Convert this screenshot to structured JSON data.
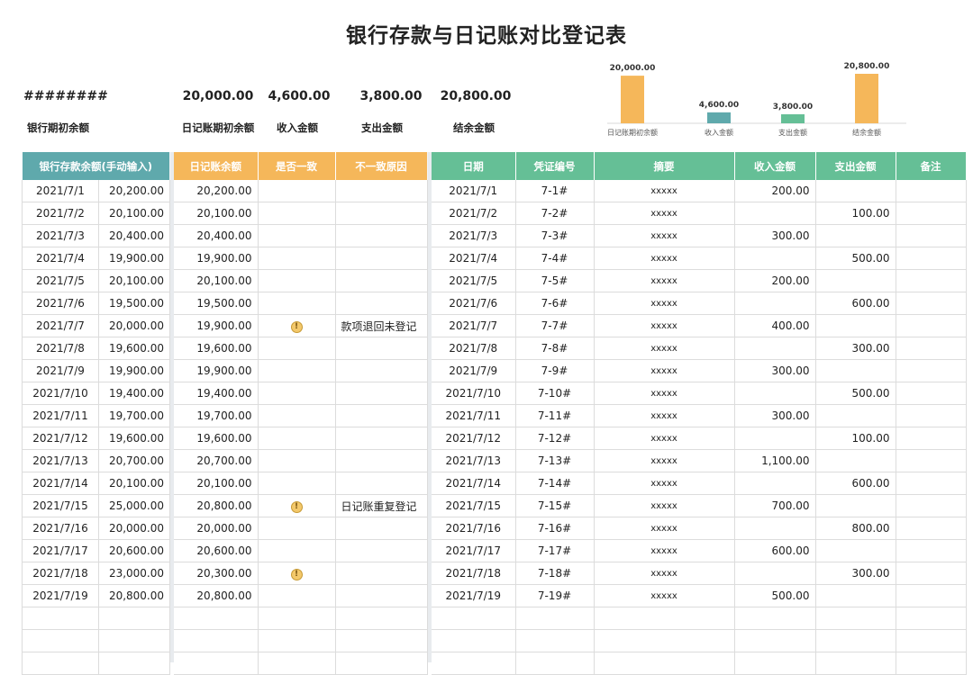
{
  "title": "银行存款与日记账对比登记表",
  "summary": {
    "bank_initial_value": "########",
    "bank_initial_label": "银行期初余额",
    "journal_initial_value": "20,000.00",
    "journal_initial_label": "日记账期初余额",
    "income_value": "4,600.00",
    "income_label": "收入金额",
    "expense_value": "3,800.00",
    "expense_label": "支出金额",
    "ending_value": "20,800.00",
    "ending_label": "结余金额"
  },
  "chart_data": {
    "type": "bar",
    "categories": [
      "日记账期初余额",
      "收入金额",
      "支出金额",
      "结余金额"
    ],
    "values": [
      20000,
      4600,
      3800,
      20800
    ],
    "value_labels": [
      "20,000.00",
      "4,600.00",
      "3,800.00",
      "20,800.00"
    ],
    "colors": [
      "#f5b75a",
      "#5fa9ac",
      "#65bf96",
      "#f5b75a"
    ],
    "ylim": [
      0,
      20800
    ],
    "grid": false
  },
  "colors": {
    "teal": "#5fa9ac",
    "orange": "#f5b75a",
    "green": "#65bf96"
  },
  "bank_table": {
    "header": "银行存款余额(手动输入)",
    "rows": [
      [
        "2021/7/1",
        "20,200.00"
      ],
      [
        "2021/7/2",
        "20,100.00"
      ],
      [
        "2021/7/3",
        "20,400.00"
      ],
      [
        "2021/7/4",
        "19,900.00"
      ],
      [
        "2021/7/5",
        "20,100.00"
      ],
      [
        "2021/7/6",
        "19,500.00"
      ],
      [
        "2021/7/7",
        "20,000.00"
      ],
      [
        "2021/7/8",
        "19,600.00"
      ],
      [
        "2021/7/9",
        "19,900.00"
      ],
      [
        "2021/7/10",
        "19,400.00"
      ],
      [
        "2021/7/11",
        "19,700.00"
      ],
      [
        "2021/7/12",
        "19,600.00"
      ],
      [
        "2021/7/13",
        "20,700.00"
      ],
      [
        "2021/7/14",
        "20,100.00"
      ],
      [
        "2021/7/15",
        "25,000.00"
      ],
      [
        "2021/7/16",
        "20,000.00"
      ],
      [
        "2021/7/17",
        "20,600.00"
      ],
      [
        "2021/7/18",
        "23,000.00"
      ],
      [
        "2021/7/19",
        "20,800.00"
      ]
    ]
  },
  "compare_table": {
    "headers": [
      "日记账余额",
      "是否一致",
      "不一致原因"
    ],
    "rows": [
      {
        "balance": "20,200.00",
        "flag": false,
        "reason": ""
      },
      {
        "balance": "20,100.00",
        "flag": false,
        "reason": ""
      },
      {
        "balance": "20,400.00",
        "flag": false,
        "reason": ""
      },
      {
        "balance": "19,900.00",
        "flag": false,
        "reason": ""
      },
      {
        "balance": "20,100.00",
        "flag": false,
        "reason": ""
      },
      {
        "balance": "19,500.00",
        "flag": false,
        "reason": ""
      },
      {
        "balance": "19,900.00",
        "flag": true,
        "reason": "款项退回未登记"
      },
      {
        "balance": "19,600.00",
        "flag": false,
        "reason": ""
      },
      {
        "balance": "19,900.00",
        "flag": false,
        "reason": ""
      },
      {
        "balance": "19,400.00",
        "flag": false,
        "reason": ""
      },
      {
        "balance": "19,700.00",
        "flag": false,
        "reason": ""
      },
      {
        "balance": "19,600.00",
        "flag": false,
        "reason": ""
      },
      {
        "balance": "20,700.00",
        "flag": false,
        "reason": ""
      },
      {
        "balance": "20,100.00",
        "flag": false,
        "reason": ""
      },
      {
        "balance": "20,800.00",
        "flag": true,
        "reason": "日记账重复登记"
      },
      {
        "balance": "20,000.00",
        "flag": false,
        "reason": ""
      },
      {
        "balance": "20,600.00",
        "flag": false,
        "reason": ""
      },
      {
        "balance": "20,300.00",
        "flag": true,
        "reason": ""
      },
      {
        "balance": "20,800.00",
        "flag": false,
        "reason": ""
      }
    ]
  },
  "journal_table": {
    "headers": [
      "日期",
      "凭证编号",
      "摘要",
      "收入金额",
      "支出金额",
      "备注"
    ],
    "rows": [
      [
        "2021/7/1",
        "7-1#",
        "xxxxx",
        "200.00",
        "",
        ""
      ],
      [
        "2021/7/2",
        "7-2#",
        "xxxxx",
        "",
        "100.00",
        ""
      ],
      [
        "2021/7/3",
        "7-3#",
        "xxxxx",
        "300.00",
        "",
        ""
      ],
      [
        "2021/7/4",
        "7-4#",
        "xxxxx",
        "",
        "500.00",
        ""
      ],
      [
        "2021/7/5",
        "7-5#",
        "xxxxx",
        "200.00",
        "",
        ""
      ],
      [
        "2021/7/6",
        "7-6#",
        "xxxxx",
        "",
        "600.00",
        ""
      ],
      [
        "2021/7/7",
        "7-7#",
        "xxxxx",
        "400.00",
        "",
        ""
      ],
      [
        "2021/7/8",
        "7-8#",
        "xxxxx",
        "",
        "300.00",
        ""
      ],
      [
        "2021/7/9",
        "7-9#",
        "xxxxx",
        "300.00",
        "",
        ""
      ],
      [
        "2021/7/10",
        "7-10#",
        "xxxxx",
        "",
        "500.00",
        ""
      ],
      [
        "2021/7/11",
        "7-11#",
        "xxxxx",
        "300.00",
        "",
        ""
      ],
      [
        "2021/7/12",
        "7-12#",
        "xxxxx",
        "",
        "100.00",
        ""
      ],
      [
        "2021/7/13",
        "7-13#",
        "xxxxx",
        "1,100.00",
        "",
        ""
      ],
      [
        "2021/7/14",
        "7-14#",
        "xxxxx",
        "",
        "600.00",
        ""
      ],
      [
        "2021/7/15",
        "7-15#",
        "xxxxx",
        "700.00",
        "",
        ""
      ],
      [
        "2021/7/16",
        "7-16#",
        "xxxxx",
        "",
        "800.00",
        ""
      ],
      [
        "2021/7/17",
        "7-17#",
        "xxxxx",
        "600.00",
        "",
        ""
      ],
      [
        "2021/7/18",
        "7-18#",
        "xxxxx",
        "",
        "300.00",
        ""
      ],
      [
        "2021/7/19",
        "7-19#",
        "xxxxx",
        "500.00",
        "",
        ""
      ]
    ]
  }
}
